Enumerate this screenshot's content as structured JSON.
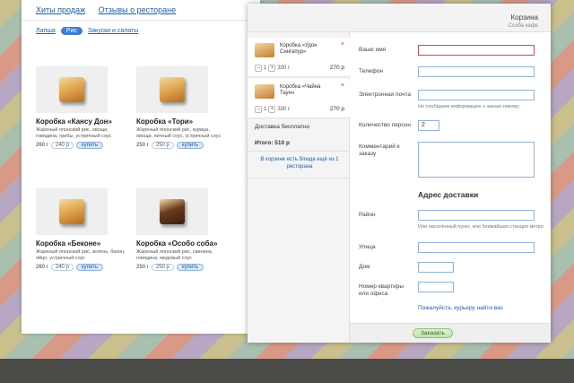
{
  "nav": {
    "hits": "Хиты продаж",
    "reviews": "Отзывы о ресторане"
  },
  "filters": {
    "noodles": "Лапша",
    "rice": "Рис",
    "salads": "Закуски и салаты"
  },
  "products": [
    {
      "name": "Коробка «Кансу Дон»",
      "desc": "Жареный японский рис, овощи, говядина, грибы, устричный соус",
      "weight": "260 г",
      "price": "240 р",
      "buy": "купить"
    },
    {
      "name": "Коробка «Тори»",
      "desc": "Жареный японский рис, курица, овощи, яичный соус, устричный соус",
      "weight": "250 г",
      "price": "250 р",
      "buy": "купить"
    },
    {
      "name": "Коробка «Беконе»",
      "desc": "Жареный японский рис, зелень, бекон, яйцо, устричный соус",
      "weight": "260 г",
      "price": "240 р",
      "buy": "купить"
    },
    {
      "name": "Коробка «Особо соба»",
      "desc": "Жареный японский рис, свинина, говядина, медовый соус",
      "weight": "250 г",
      "price": "250 р",
      "buy": "купить"
    }
  ],
  "cart": {
    "title": "Корзина",
    "subtitle": "Ссоба кафе",
    "items": [
      {
        "name": "Коробка «Удон Сингапур»",
        "qty": "1",
        "weight": "330 г",
        "sum": "270 р"
      },
      {
        "name": "Коробка «Чайна Таун»",
        "qty": "1",
        "weight": "330 г",
        "sum": "270 р"
      }
    ],
    "delivery": "Доставка бесплатно",
    "total": "Итого: 510 р",
    "note": "В корзине есть блюда ещё из 1 ресторана",
    "remove_symbol": "×",
    "minus": "–",
    "plus": "+"
  },
  "form": {
    "name_label": "Ваше имя",
    "phone_label": "Телефон",
    "email_label": "Электронная почта",
    "email_hint": "Не сообщаем информацию о заказе никому",
    "persons_label": "Количество персон",
    "persons_value": "2",
    "comment_label": "Комментарий к заказу",
    "address_title": "Адрес доставки",
    "city_label": "Район",
    "city_hint": "Или населённый пункт, или ближайшая станция метро",
    "street_label": "Улица",
    "house_label": "Дом",
    "apt_label": "Номер квартиры или офиса",
    "courier_link": "Пожалуйста, курьеру найти вас",
    "submit_label": "Заказать"
  },
  "colors": {
    "link": "#1f5fa8",
    "accent": "#3c7fcf",
    "submit": "#bfe2aa"
  }
}
